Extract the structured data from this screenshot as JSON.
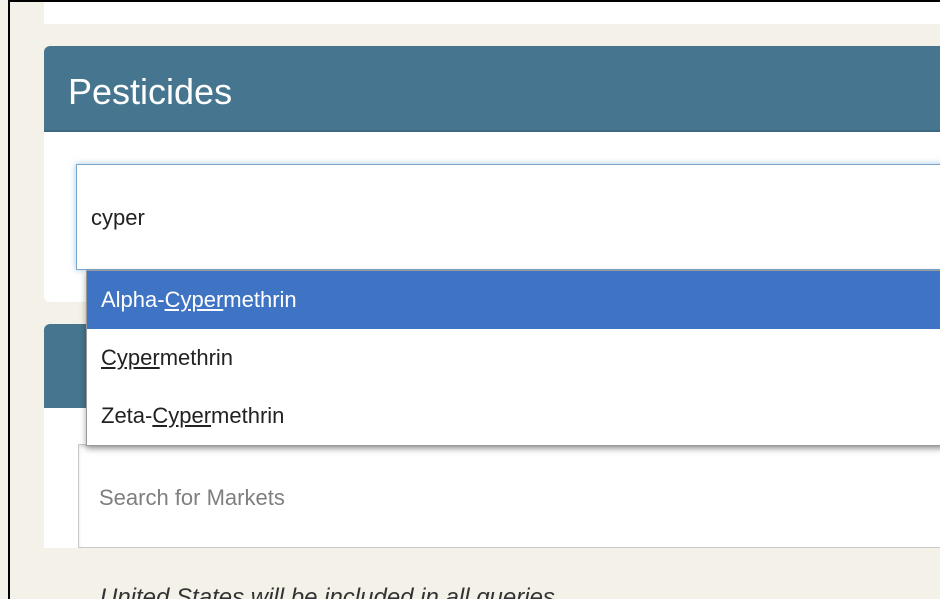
{
  "pesticides": {
    "title": "Pesticides",
    "search_value": "cyper",
    "suggestions": [
      {
        "prefix": "Alpha-",
        "match": "Cyper",
        "suffix": "methrin",
        "active": true
      },
      {
        "prefix": "",
        "match": "Cyper",
        "suffix": "methrin",
        "active": false
      },
      {
        "prefix": "Zeta-",
        "match": "Cyper",
        "suffix": "methrin",
        "active": false
      }
    ]
  },
  "markets": {
    "placeholder": "Search for Markets"
  },
  "note": "United States will be included in all queries",
  "colors": {
    "header": "#46768f",
    "active": "#3f74c4",
    "page_bg": "#f4f1e8"
  }
}
